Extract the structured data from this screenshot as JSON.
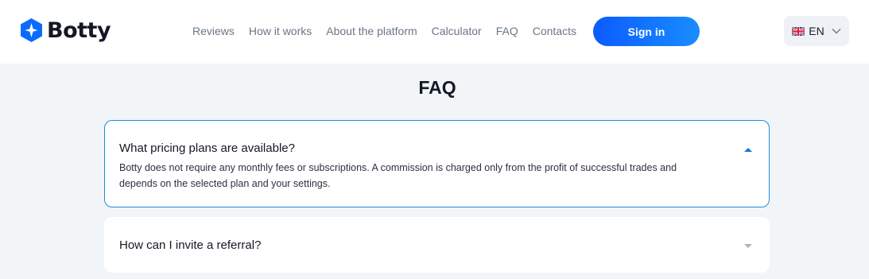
{
  "brand": {
    "name": "Botty",
    "accent": "#0a5cff"
  },
  "nav": {
    "items": [
      {
        "label": "Reviews"
      },
      {
        "label": "How it works"
      },
      {
        "label": "About the platform"
      },
      {
        "label": "Calculator"
      },
      {
        "label": "FAQ"
      },
      {
        "label": "Contacts"
      }
    ]
  },
  "header": {
    "signin_label": "Sign in",
    "language": "EN"
  },
  "faq": {
    "title": "FAQ",
    "items": [
      {
        "question": "What pricing plans are available?",
        "answer_lines": [
          "Botty does not require any monthly fees or subscriptions. A commission is charged only from the profit of successful trades and",
          "depends on the selected plan and your settings."
        ],
        "expanded": true,
        "toggle_icon": "chevron-up-icon"
      },
      {
        "question": "How can I invite a referral?",
        "expanded": false,
        "toggle_icon": "chevron-down-icon"
      }
    ]
  }
}
